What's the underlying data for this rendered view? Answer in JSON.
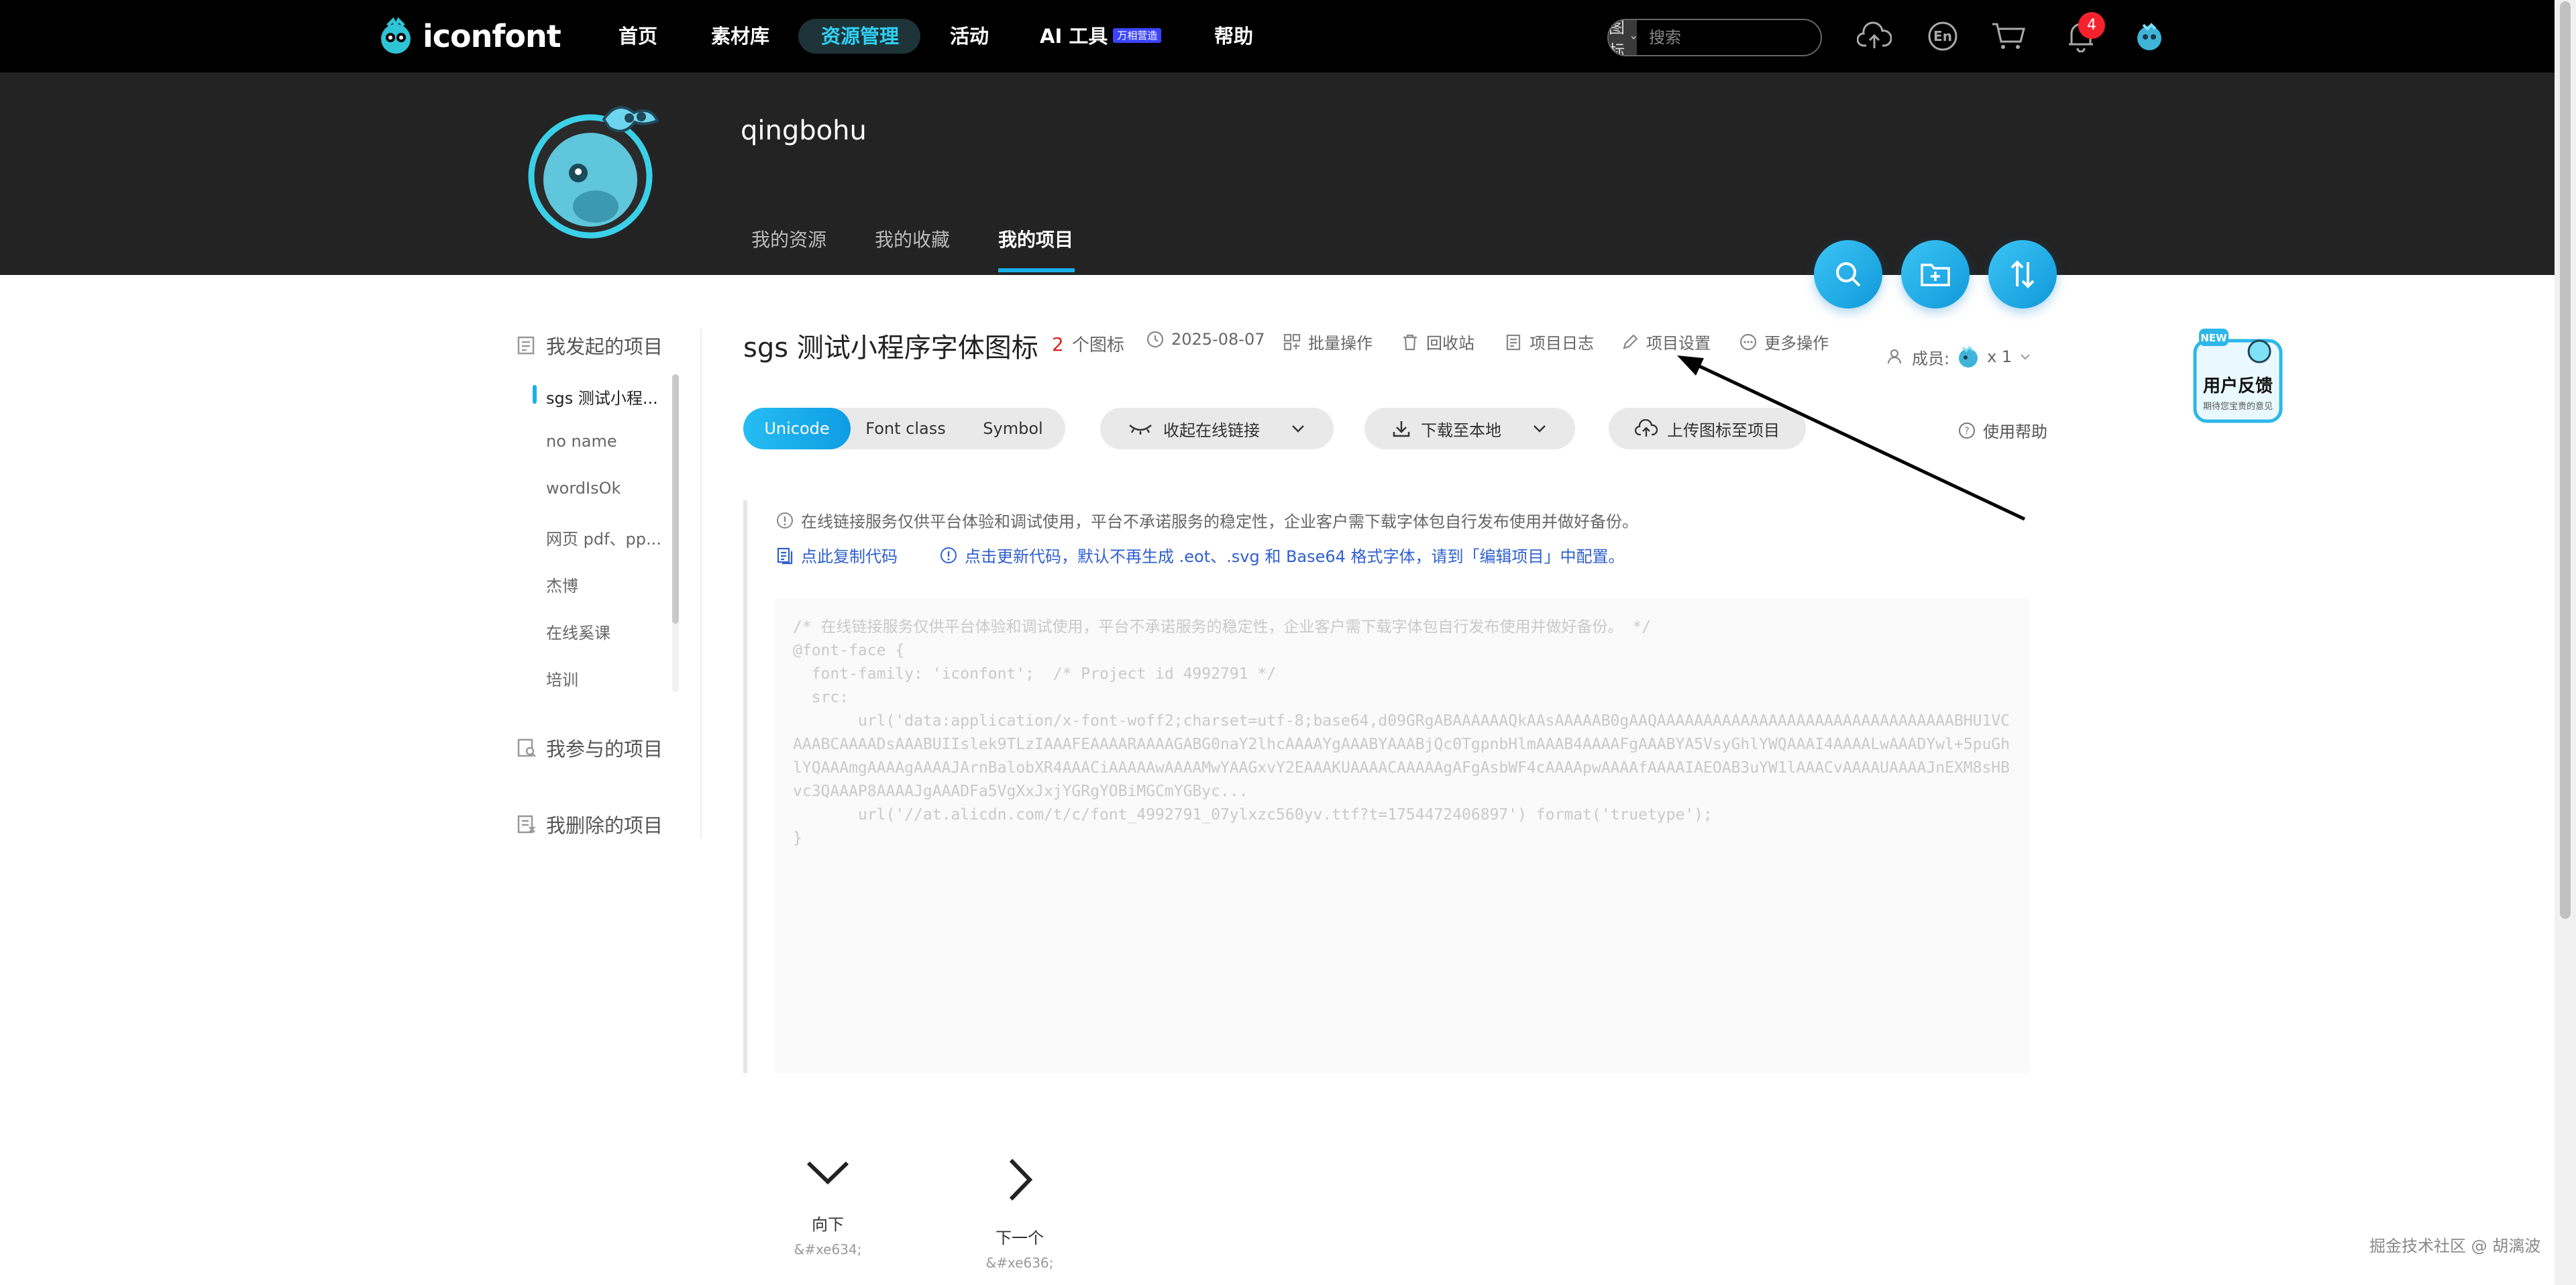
{
  "app": {
    "logo_text": "iconfont"
  },
  "topnav": {
    "items": [
      "首页",
      "素材库",
      "资源管理",
      "活动",
      "AI 工具",
      "帮助"
    ],
    "active": "资源管理",
    "ai_badge": "万相营造",
    "search_type": "图标",
    "search_placeholder": "搜索",
    "language": "En",
    "notification_count": "4"
  },
  "profile": {
    "username": "qingbohu",
    "tabs": [
      "我的资源",
      "我的收藏",
      "我的项目"
    ],
    "active_tab": "我的项目"
  },
  "sidebar": {
    "started_title": "我发起的项目",
    "projects": [
      "sgs 测试小程...",
      "no name",
      "wordIsOk",
      "网页 pdf、pp...",
      "杰博",
      "在线奚课",
      "培训"
    ],
    "active_project": "sgs 测试小程...",
    "participated_title": "我参与的项目",
    "deleted_title": "我删除的项目"
  },
  "project": {
    "title": "sgs 测试小程序字体图标",
    "icon_count": "2",
    "icon_count_label": "个图标",
    "date": "2025-08-07",
    "actions": [
      "批量操作",
      "回收站",
      "项目日志",
      "项目设置",
      "更多操作"
    ],
    "members_label": "成员:",
    "members_count": "x 1"
  },
  "toolbar": {
    "type_tabs": [
      "Unicode",
      "Font class",
      "Symbol"
    ],
    "active_type": "Unicode",
    "collapse_link": "收起在线链接",
    "download": "下载至本地",
    "upload": "上传图标至项目",
    "help": "使用帮助"
  },
  "notice": {
    "line1": "在线链接服务仅供平台体验和调试使用，平台不承诺服务的稳定性，企业客户需下载字体包自行发布使用并做好备份。",
    "copy_code": "点此复制代码",
    "update_code": "点击更新代码，默认不再生成 .eot、.svg 和 Base64 格式字体，请到「编辑项目」中配置。"
  },
  "code": "/* 在线链接服务仅供平台体验和调试使用，平台不承诺服务的稳定性，企业客户需下载字体包自行发布使用并做好备份。 */\n@font-face {\n  font-family: 'iconfont';  /* Project id 4992791 */\n  src:\n       url('data:application/x-font-woff2;charset=utf-8;base64,d09GRgABAAAAAAQkAAsAAAAAB0gAAQAAAAAAAAAAAAAAAAAAAAAAAAAAAAAAAABHU1VCAAABCAAAADsAAABUIIslek9TLzIAAAFEAAAARAAAAGABG0naY2lhcAAAAYgAAABYAAABjQc0TgpnbHlmAAAB4AAAAFgAAABYA5VsyGhlYWQAAAI4AAAALwAAADYwl+5puGhlYQAAAmgAAAAgAAAAJArnBalobXR4AAACiAAAAAwAAAAMwYAAGxvY2EAAAKUAAAACAAAAAgAFgAsbWF4cAAAApwAAAAfAAAAIAEOAB3uYW1lAAACvAAAAUAAAAJnEXM8sHBvc3QAAAP8AAAAJgAAADFa5VgXxJxjYGRgYOBiMGCmYGByc...\n       url('//at.alicdn.com/t/c/font_4992791_07ylxzc560yv.ttf?t=1754472406897') format('truetype');\n}",
  "glyphs": [
    {
      "name": "向下",
      "code": "&#xe634;"
    },
    {
      "name": "下一个",
      "code": "&#xe636;"
    }
  ],
  "feedback": {
    "new_tag": "NEW",
    "title": "用户反馈",
    "subtitle": "期待您宝贵的意见"
  },
  "watermark": "掘金技术社区 @ 胡漓波",
  "colors": {
    "accent": "#1ab0e8",
    "topnav_bg": "#000000",
    "header_bg": "#232323",
    "badge_red": "#f5222d",
    "link_blue": "#2f5fd0"
  }
}
